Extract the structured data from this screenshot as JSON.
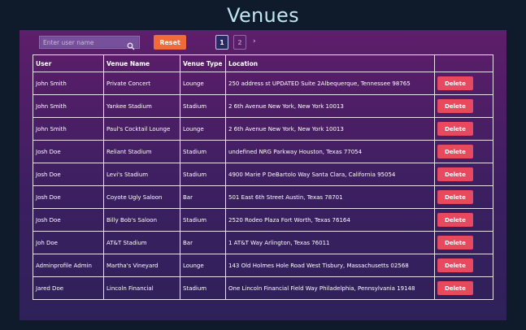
{
  "page": {
    "title": "Venues"
  },
  "search": {
    "placeholder": "Enter user name",
    "value": ""
  },
  "controls": {
    "reset_label": "Reset"
  },
  "pagination": {
    "pages": [
      "1",
      "2"
    ],
    "current": "1",
    "next": "›"
  },
  "table": {
    "headers": [
      "User",
      "Venue Name",
      "Venue Type",
      "Location",
      ""
    ],
    "delete_label": "Delete",
    "rows": [
      {
        "user": "John Smith",
        "venue": "Private Concert",
        "type": "Lounge",
        "location": "250 address st UPDATED Suite 2Albequerque, Tennessee 98765"
      },
      {
        "user": "John Smith",
        "venue": "Yankee Stadium",
        "type": "Stadium",
        "location": "2 6th Avenue New York, New York 10013"
      },
      {
        "user": "John Smith",
        "venue": "Paul's Cocktail Lounge",
        "type": "Lounge",
        "location": "2 6th Avenue New York, New York 10013"
      },
      {
        "user": "Josh Doe",
        "venue": "Reliant Stadium",
        "type": "Stadium",
        "location": "undefined NRG Parkway Houston, Texas 77054"
      },
      {
        "user": "Josh Doe",
        "venue": "Levi's Stadium",
        "type": "Stadium",
        "location": "4900 Marie P DeBartolo Way Santa Clara, California 95054"
      },
      {
        "user": "Josh Doe",
        "venue": "Coyote Ugly Saloon",
        "type": "Bar",
        "location": "501 East 6th Street Austin, Texas 78701"
      },
      {
        "user": "Josh Doe",
        "venue": "Billy Bob's Saloon",
        "type": "Stadium",
        "location": "2520 Rodeo Plaza Fort Worth, Texas 76164"
      },
      {
        "user": "Joh Doe",
        "venue": "AT&T Stadium",
        "type": "Bar",
        "location": "1 AT&T Way Arlington, Texas 76011"
      },
      {
        "user": "Adminprofile Admin",
        "venue": "Martha's Vineyard",
        "type": "Lounge",
        "location": "143 Old Holmes Hole Road West Tisbury, Massachusetts 02568"
      },
      {
        "user": "Jared Doe",
        "venue": "Lincoln Financial",
        "type": "Stadium",
        "location": "One Lincoln Financial Field Way Philadelphia, Pennsylvania 19148"
      }
    ]
  }
}
